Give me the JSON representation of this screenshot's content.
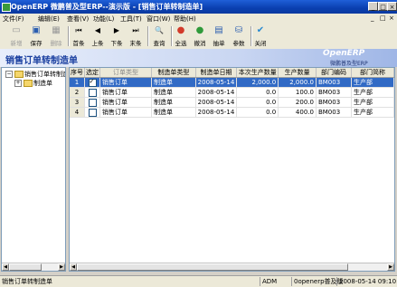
{
  "window": {
    "title": "OpenERP 微鹏普及型ERP--演示版 - [销售订单转制造单]",
    "app_icon": "app-icon",
    "min_glyph": "_",
    "max_glyph": "□",
    "close_glyph": "×"
  },
  "menu": {
    "items": [
      "文件(F)",
      "编辑(E)",
      "查看(V)",
      "功能(L)",
      "工具(T)",
      "窗口(W)",
      "帮助(H)"
    ],
    "child_controls": [
      "_",
      "□",
      "×"
    ]
  },
  "toolbar": {
    "new": {
      "label": "新增",
      "icon": "new-icon",
      "glyph": "▭",
      "enabled": false
    },
    "save": {
      "label": "保存",
      "icon": "save-icon",
      "glyph": "▣",
      "enabled": true
    },
    "delete": {
      "label": "删除",
      "icon": "delete-icon",
      "glyph": "▦",
      "enabled": false
    },
    "first": {
      "label": "首条",
      "icon": "first-record-icon",
      "glyph": "⏮"
    },
    "prev": {
      "label": "上条",
      "icon": "previous-record-icon",
      "glyph": "◀"
    },
    "next": {
      "label": "下条",
      "icon": "next-record-icon",
      "glyph": "▶"
    },
    "last": {
      "label": "末条",
      "icon": "last-record-icon",
      "glyph": "⏭"
    },
    "query": {
      "label": "查询",
      "icon": "query-icon",
      "glyph": "🔍"
    },
    "select_all": {
      "label": "全选",
      "icon": "select-all-icon",
      "glyph": "●"
    },
    "cancel_select": {
      "label": "撤消",
      "icon": "undo-icon",
      "glyph": "●"
    },
    "draw": {
      "label": "抽单",
      "icon": "draw-order-icon",
      "glyph": "▤"
    },
    "params": {
      "label": "参数",
      "icon": "parameters-icon",
      "glyph": "⛁"
    },
    "close": {
      "label": "关闭",
      "icon": "close-icon",
      "glyph": "✔"
    }
  },
  "brand": {
    "logo_text": "OpenERP",
    "tagline": "微鹏普及型ERP"
  },
  "page_title": "销售订单转制造单",
  "tree": {
    "root": {
      "label": "销售订单转制造单",
      "expander": "−"
    },
    "child": {
      "label": "制造单",
      "expander": "+"
    }
  },
  "grid": {
    "columns": [
      "序号",
      "选定",
      "订单类型",
      "制造单类型",
      "制造单日期",
      "本次生产数量",
      "生产数量",
      "部门编码",
      "部门简称"
    ],
    "rows": [
      {
        "no": "1",
        "checked": true,
        "order_type": "销售订单",
        "mo_type": "制造单",
        "date": "2008-05-14",
        "this_qty": "2,000.0",
        "qty": "2,000.0",
        "dept_code": "BM003",
        "dept_name": "生产部",
        "selected": true
      },
      {
        "no": "2",
        "checked": false,
        "order_type": "销售订单",
        "mo_type": "制造单",
        "date": "2008-05-14",
        "this_qty": "0.0",
        "qty": "100.0",
        "dept_code": "BM003",
        "dept_name": "生产部",
        "selected": false
      },
      {
        "no": "3",
        "checked": false,
        "order_type": "销售订单",
        "mo_type": "制造单",
        "date": "2008-05-14",
        "this_qty": "0.0",
        "qty": "200.0",
        "dept_code": "BM003",
        "dept_name": "生产部",
        "selected": false
      },
      {
        "no": "4",
        "checked": false,
        "order_type": "销售订单",
        "mo_type": "制造单",
        "date": "2008-05-14",
        "this_qty": "0.0",
        "qty": "400.0",
        "dept_code": "BM003",
        "dept_name": "生产部",
        "selected": false
      }
    ]
  },
  "statusbar": {
    "module": "销售订单转制造单",
    "user": "ADM",
    "account": "0openerp普及版",
    "datetime": "2008-05-14 09:10:06"
  },
  "colors": {
    "accent": "#316ac5",
    "title_bar": "#0a3fb0",
    "header_text": "#1a3fa0"
  }
}
